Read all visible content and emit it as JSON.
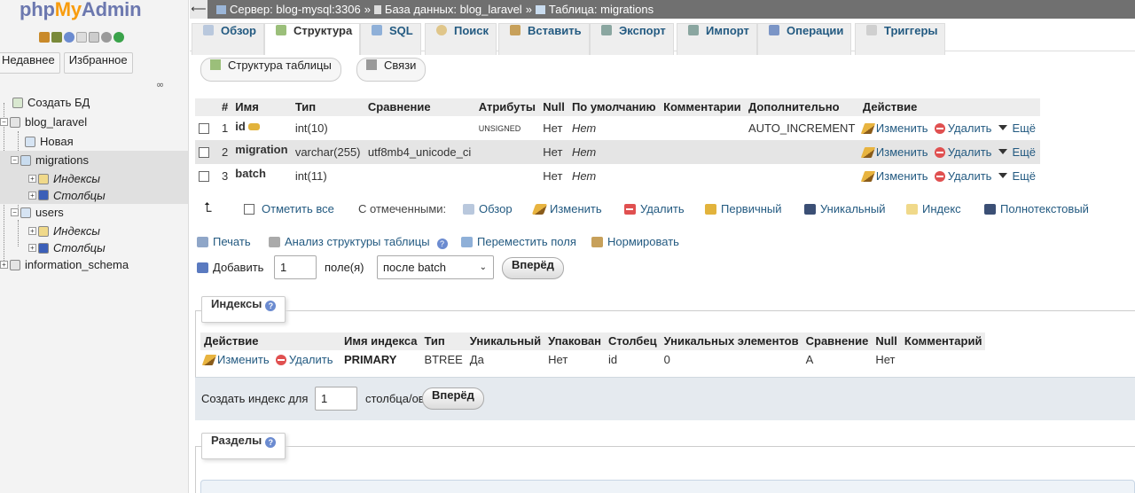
{
  "sidebar": {
    "logo_php": "php",
    "logo_my": "My",
    "logo_admin": "Admin",
    "recent": "Недавнее",
    "favorites": "Избранное",
    "link_icon": "∞",
    "tree": {
      "create_db": "Создать БД",
      "db": "blog_laravel",
      "new": "Новая",
      "migrations": "migrations",
      "indexes": "Индексы",
      "columns": "Столбцы",
      "users": "users",
      "indexes2": "Индексы",
      "columns2": "Столбцы",
      "info": "information_schema"
    }
  },
  "topbar": {
    "server": "Сервер: blog-mysql:3306",
    "db": "База данных: blog_laravel",
    "table": "Таблица: migrations",
    "sep": "»"
  },
  "tabs": [
    "Обзор",
    "Структура",
    "SQL",
    "Поиск",
    "Вставить",
    "Экспорт",
    "Импорт",
    "Операции",
    "Триггеры"
  ],
  "subtabs": [
    "Структура таблицы",
    "Связи"
  ],
  "structure": {
    "headers": [
      "#",
      "Имя",
      "Тип",
      "Сравнение",
      "Атрибуты",
      "Null",
      "По умолчанию",
      "Комментарии",
      "Дополнительно",
      "Действие"
    ],
    "rows": [
      {
        "num": "1",
        "name": "id",
        "type": "int(10)",
        "collation": "",
        "attributes": "UNSIGNED",
        "null": "Нет",
        "default": "Нет",
        "extra": "AUTO_INCREMENT"
      },
      {
        "num": "2",
        "name": "migration",
        "type": "varchar(255)",
        "collation": "utf8mb4_unicode_ci",
        "attributes": "",
        "null": "Нет",
        "default": "Нет",
        "extra": ""
      },
      {
        "num": "3",
        "name": "batch",
        "type": "int(11)",
        "collation": "",
        "attributes": "",
        "null": "Нет",
        "default": "Нет",
        "extra": ""
      }
    ],
    "actions": {
      "edit": "Изменить",
      "delete": "Удалить",
      "more": "Ещё"
    }
  },
  "bulk": {
    "check_all": "Отметить все",
    "with_selected": "С отмеченными:",
    "browse": "Обзор",
    "edit": "Изменить",
    "delete": "Удалить",
    "primary": "Первичный",
    "unique": "Уникальный",
    "index": "Индекс",
    "fulltext": "Полнотекстовый"
  },
  "tools": {
    "print": "Печать",
    "analyze": "Анализ структуры таблицы",
    "move": "Переместить поля",
    "normalize": "Нормировать"
  },
  "add": {
    "label": "Добавить",
    "value": "1",
    "fields": "поле(я)",
    "position": "после batch",
    "go": "Вперёд"
  },
  "indexes": {
    "legend": "Индексы",
    "headers": [
      "Действие",
      "Имя индекса",
      "Тип",
      "Уникальный",
      "Упакован",
      "Столбец",
      "Уникальных элементов",
      "Сравнение",
      "Null",
      "Комментарий"
    ],
    "row": {
      "edit": "Изменить",
      "delete": "Удалить",
      "name": "PRIMARY",
      "type": "BTREE",
      "unique": "Да",
      "packed": "Нет",
      "column": "id",
      "cardinality": "0",
      "collation": "A",
      "null": "Нет",
      "comment": ""
    },
    "create_label": "Создать индекс для",
    "create_value": "1",
    "create_cols": "столбца/ов",
    "go": "Вперёд"
  },
  "partitions": {
    "legend": "Разделы"
  }
}
